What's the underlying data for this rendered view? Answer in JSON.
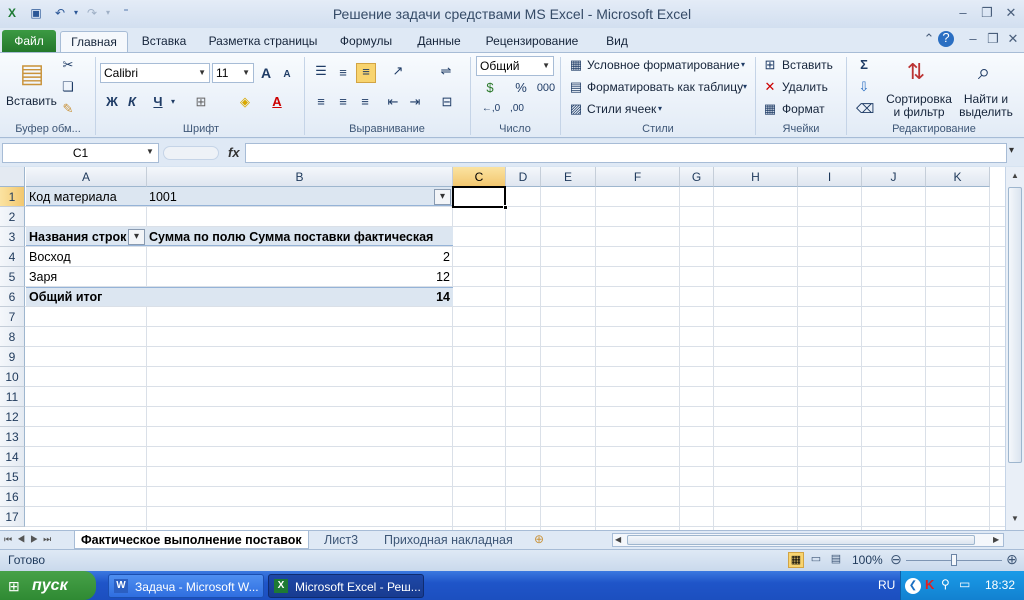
{
  "window": {
    "title": "Решение задачи средствами MS Excel  -  Microsoft Excel"
  },
  "tabs": [
    "Файл",
    "Главная",
    "Вставка",
    "Разметка страницы",
    "Формулы",
    "Данные",
    "Рецензирование",
    "Вид"
  ],
  "ribbon": {
    "clipboard": {
      "paste": "Вставить",
      "label": "Буфер обм..."
    },
    "font": {
      "name": "Calibri",
      "size": "11",
      "bold": "Ж",
      "italic": "К",
      "underline": "Ч",
      "grow": "A",
      "shrink": "A",
      "label": "Шрифт"
    },
    "alignment": {
      "label": "Выравнивание"
    },
    "number": {
      "format": "Общий",
      "percent": "%",
      "thousands": "000",
      "inc_dec": "←,0",
      "dec_dec": ",00",
      "label": "Число"
    },
    "styles": {
      "conditional": "Условное форматирование",
      "table": "Форматировать как таблицу",
      "cell_styles": "Стили ячеек",
      "label": "Стили"
    },
    "cells": {
      "insert": "Вставить",
      "delete": "Удалить",
      "format": "Формат",
      "label": "Ячейки"
    },
    "editing": {
      "sort": "Сортировка\nи фильтр",
      "sort_l1": "Сортировка",
      "sort_l2": "и фильтр",
      "find_l1": "Найти и",
      "find_l2": "выделить",
      "label": "Редактирование"
    }
  },
  "formula_bar": {
    "name_box": "C1",
    "fx": "fx",
    "value": ""
  },
  "columns": [
    "A",
    "B",
    "C",
    "D",
    "E",
    "F",
    "G",
    "H",
    "I",
    "J",
    "K"
  ],
  "rows": [
    "1",
    "2",
    "3",
    "4",
    "5",
    "6",
    "7",
    "8",
    "9",
    "10",
    "11",
    "12",
    "13",
    "14",
    "15",
    "16",
    "17"
  ],
  "cells": {
    "A1": "Код материала",
    "B1": "1001",
    "A3": "Названия строк",
    "B3": "Сумма по полю Сумма поставки фактическая",
    "A4": "Восход",
    "B4": "2",
    "A5": "Заря",
    "B5": "12",
    "A6": "Общий итог",
    "B6": "14"
  },
  "sheets": [
    "Фактическое выполнение поставок",
    "Лист3",
    "Приходная накладная"
  ],
  "status": {
    "ready": "Готово",
    "zoom": "100%"
  },
  "taskbar": {
    "start": "пуск",
    "apps": [
      "Задача - Microsoft W...",
      "Microsoft Excel - Реш..."
    ],
    "lang": "RU",
    "time": "18:32"
  },
  "colors": {
    "pivot_header": "#dce6f1",
    "accent": "#2b5797",
    "file_tab": "#2e8b36"
  }
}
